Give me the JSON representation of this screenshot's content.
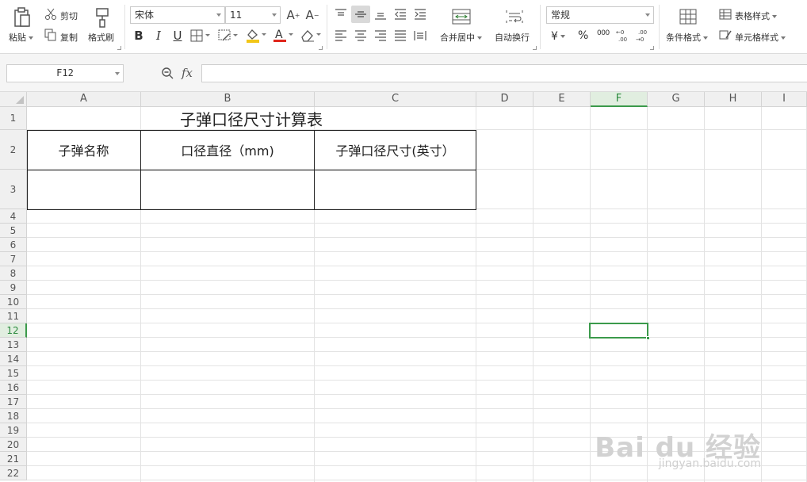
{
  "ribbon": {
    "paste": "粘贴",
    "cut": "剪切",
    "copy": "复制",
    "format_painter": "格式刷",
    "font_name": "宋体",
    "font_size": "11",
    "merge_center": "合并居中",
    "wrap_text": "自动换行",
    "number_format": "常规",
    "currency_symbol": "¥",
    "percent_symbol": "%",
    "thousands_symbol": "000",
    "conditional_format": "条件格式",
    "table_style": "表格样式",
    "cell_style": "单元格样式",
    "bold": "B",
    "italic": "I",
    "underline": "U"
  },
  "formula_bar": {
    "name_box": "F12",
    "fx": "fx",
    "formula": ""
  },
  "columns": [
    "A",
    "B",
    "C",
    "D",
    "E",
    "F",
    "G",
    "H",
    "I"
  ],
  "rows": [
    "1",
    "2",
    "3",
    "4",
    "5",
    "6",
    "7",
    "8",
    "9",
    "10",
    "11",
    "12",
    "13",
    "14",
    "15",
    "16",
    "17",
    "18",
    "19",
    "20",
    "21",
    "22"
  ],
  "active_cell": {
    "column": "F",
    "row": "12"
  },
  "sheet": {
    "title": "子弹口径尺寸计算表",
    "header_a": "子弹名称",
    "header_b": "口径直径（mm)",
    "header_c": "子弹口径尺寸(英寸）"
  },
  "watermark": {
    "brand": "Bai du 经验",
    "url": "jingyan.baidu.com"
  },
  "colors": {
    "accent_green": "#3b9a4b",
    "header_bg": "#f0f0f0",
    "gridline": "#e3e3e3"
  }
}
